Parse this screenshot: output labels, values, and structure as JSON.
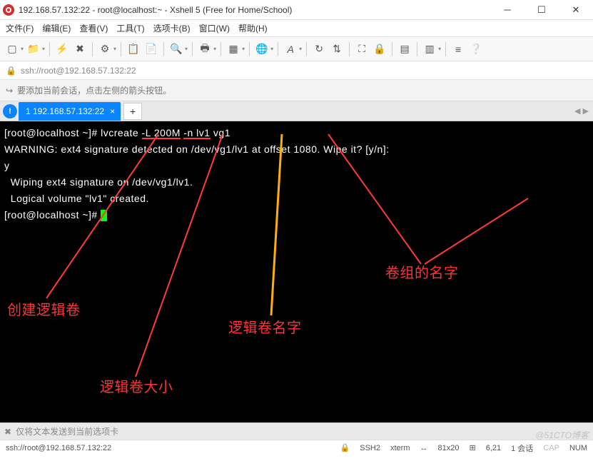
{
  "window": {
    "title": "192.168.57.132:22 - root@localhost:~ - Xshell 5 (Free for Home/School)"
  },
  "menu": {
    "file": "文件(F)",
    "edit": "编辑(E)",
    "view": "查看(V)",
    "tools": "工具(T)",
    "tab": "选项卡(B)",
    "window": "窗口(W)",
    "help": "帮助(H)"
  },
  "address": {
    "url": "ssh://root@192.168.57.132:22"
  },
  "info": {
    "message": "要添加当前会话，点击左侧的箭头按钮。"
  },
  "tabs": {
    "active": "1 192.168.57.132:22",
    "indicator": "!"
  },
  "terminal": {
    "line1_prompt": "[root@localhost ~]# ",
    "line1_cmd1": "lvcreate ",
    "line1_cmd2": "-L 200M",
    "line1_cmd3": " ",
    "line1_cmd4": "-n lv1",
    "line1_cmd5": " ",
    "line1_cmd6": "vg1",
    "line2": "WARNING: ext4 signature detected on /dev/vg1/lv1 at offset 1080. Wipe it? [y/n]:",
    "line3": "y",
    "line4": "  Wiping ext4 signature on /dev/vg1/lv1.",
    "line5": "  Logical volume \"lv1\" created.",
    "line6_prompt": "[root@localhost ~]# "
  },
  "annotations": {
    "a1": "创建逻辑卷",
    "a2": "逻辑卷大小",
    "a3": "逻辑卷名字",
    "a4": "卷组的名字"
  },
  "send": {
    "text": "仅将文本发送到当前选项卡"
  },
  "status": {
    "left": "ssh://root@192.168.57.132:22",
    "ssh": "SSH2",
    "term": "xterm",
    "size": "81x20",
    "pos": "6,21",
    "sess": "1 会话",
    "caps": "CAP",
    "num": "NUM"
  },
  "watermark": "@51CTO博客"
}
